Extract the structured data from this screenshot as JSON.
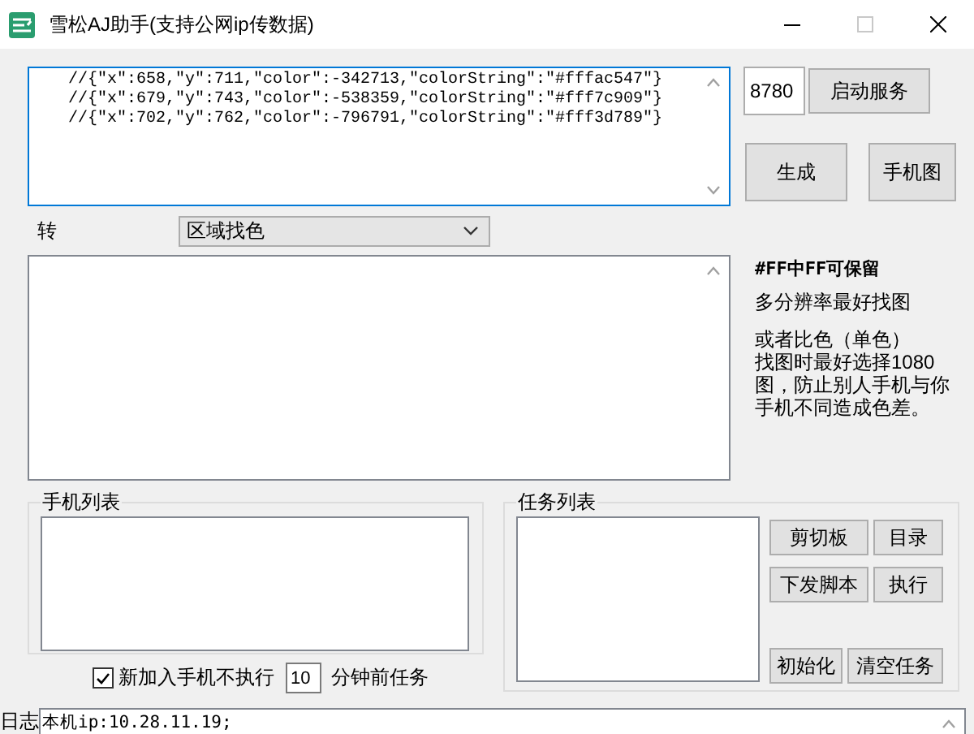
{
  "window": {
    "title": "雪松AJ助手(支持公网ip传数据)"
  },
  "code_editor": {
    "lines": [
      "//{\"x\":658,\"y\":711,\"color\":-342713,\"colorString\":\"#fffac547\"}",
      "//{\"x\":679,\"y\":743,\"color\":-538359,\"colorString\":\"#fff7c909\"}",
      "//{\"x\":702,\"y\":762,\"color\":-796791,\"colorString\":\"#fff3d789\"}"
    ]
  },
  "port_field": {
    "value": "8780"
  },
  "start_button": "启动服务",
  "action_buttons": [
    "生成",
    "手机图"
  ],
  "convert_label": "转",
  "mode_dropdown": {
    "value": "区域找色"
  },
  "notes": [
    "#FF中FF可保留",
    "多分辨率最好找图",
    "或者比色（单色）",
    "找图时最好选择1080图，防止别人手机与你手机不同造成色差。"
  ],
  "phone_list": {
    "title": "手机列表"
  },
  "skip_option": {
    "label": "新加入手机不执行",
    "checked": true,
    "minutes": "10",
    "suffix": "分钟前任务"
  },
  "task_list": {
    "title": "任务列表"
  },
  "task_buttons": [
    [
      "剪切板",
      "目录"
    ],
    [
      "下发脚本",
      "执行"
    ],
    [
      "初始化",
      "清空任务"
    ]
  ],
  "log": {
    "label": "日志",
    "text": "本机ip:10.28.11.19;"
  }
}
